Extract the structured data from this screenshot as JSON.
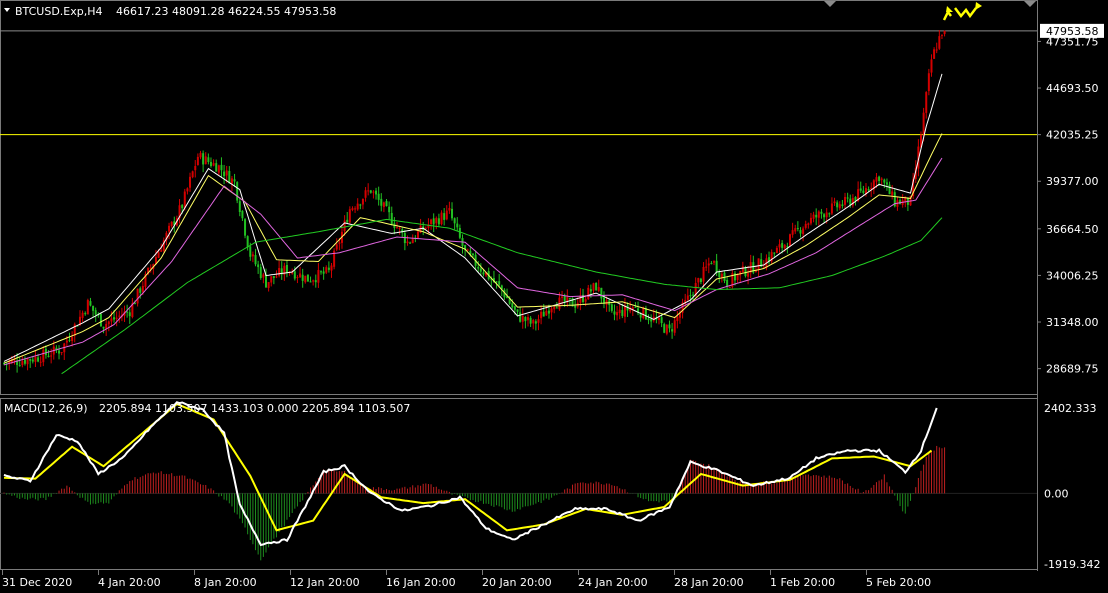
{
  "header": {
    "symbol": "BTCUSD.Exp,H4",
    "ohlc": "46617.23 48091.28 46224.55 47953.58"
  },
  "macd_header": {
    "label": "MACD(12,26,9)",
    "values": "2205.894 1103.507 1433.103 0.000 2205.894 1103.507"
  },
  "current_price_label": "47953.58",
  "colors": {
    "background": "#000000",
    "bull": "#d40000",
    "bear": "#22c022",
    "ma_fast": "#ffffff",
    "ma_mid": "#ffff66",
    "ma_slow": "#e066e0",
    "ma_long": "#22cc22",
    "level_line": "#ffff00",
    "macd_line": "#ffffff",
    "signal_line": "#ffff00",
    "hist_pos": "#c02020",
    "hist_neg": "#1e8c1e",
    "arrows": "#ffff00"
  },
  "chart_data": [
    {
      "type": "candlestick",
      "title": "BTCUSD.Exp,H4",
      "yticks": [
        "47351.75",
        "44693.50",
        "42035.25",
        "39377.00",
        "36664.50",
        "34006.25",
        "31348.00",
        "28689.75"
      ],
      "ylim": [
        27500,
        49000
      ],
      "level_line": 42035.25,
      "xticks": [
        "31 Dec 2020",
        "4 Jan 20:00",
        "8 Jan 20:00",
        "12 Jan 20:00",
        "16 Jan 20:00",
        "20 Jan 20:00",
        "24 Jan 20:00",
        "28 Jan 20:00",
        "1 Feb 20:00",
        "5 Feb 20:00"
      ],
      "close_path": [
        [
          0,
          29000
        ],
        [
          12,
          29300
        ],
        [
          22,
          29800
        ],
        [
          32,
          32400
        ],
        [
          38,
          31200
        ],
        [
          48,
          32000
        ],
        [
          60,
          35700
        ],
        [
          68,
          38000
        ],
        [
          74,
          40800
        ],
        [
          82,
          40200
        ],
        [
          88,
          39300
        ],
        [
          94,
          35200
        ],
        [
          100,
          33600
        ],
        [
          108,
          34400
        ],
        [
          116,
          33800
        ],
        [
          124,
          34200
        ],
        [
          132,
          37800
        ],
        [
          140,
          38900
        ],
        [
          148,
          37200
        ],
        [
          154,
          35900
        ],
        [
          162,
          36900
        ],
        [
          170,
          37600
        ],
        [
          176,
          35300
        ],
        [
          182,
          34400
        ],
        [
          190,
          33200
        ],
        [
          196,
          31700
        ],
        [
          202,
          31200
        ],
        [
          210,
          32500
        ],
        [
          218,
          32400
        ],
        [
          226,
          33400
        ],
        [
          232,
          31700
        ],
        [
          240,
          32200
        ],
        [
          248,
          31500
        ],
        [
          254,
          30800
        ],
        [
          260,
          32400
        ],
        [
          270,
          34900
        ],
        [
          276,
          33600
        ],
        [
          282,
          34200
        ],
        [
          290,
          34800
        ],
        [
          298,
          35800
        ],
        [
          306,
          37000
        ],
        [
          314,
          37700
        ],
        [
          322,
          38200
        ],
        [
          328,
          38800
        ],
        [
          334,
          39700
        ],
        [
          340,
          38200
        ],
        [
          346,
          38200
        ],
        [
          350,
          42100
        ],
        [
          354,
          46300
        ],
        [
          358,
          47953
        ]
      ],
      "moving_averages": [
        {
          "name": "ma_fast",
          "path": [
            [
              0,
              29100
            ],
            [
              30,
              31300
            ],
            [
              40,
              32100
            ],
            [
              60,
              35600
            ],
            [
              78,
              40100
            ],
            [
              90,
              38900
            ],
            [
              100,
              34000
            ],
            [
              110,
              34200
            ],
            [
              130,
              37000
            ],
            [
              148,
              36400
            ],
            [
              160,
              36700
            ],
            [
              176,
              35000
            ],
            [
              196,
              31700
            ],
            [
              210,
              32300
            ],
            [
              226,
              33000
            ],
            [
              248,
              31500
            ],
            [
              262,
              32600
            ],
            [
              272,
              34200
            ],
            [
              290,
              34600
            ],
            [
              306,
              36300
            ],
            [
              322,
              37900
            ],
            [
              334,
              39200
            ],
            [
              346,
              38700
            ],
            [
              352,
              42500
            ],
            [
              358,
              45500
            ]
          ]
        },
        {
          "name": "ma_mid",
          "path": [
            [
              0,
              29000
            ],
            [
              30,
              30800
            ],
            [
              40,
              31600
            ],
            [
              60,
              35000
            ],
            [
              78,
              39700
            ],
            [
              92,
              38200
            ],
            [
              104,
              34900
            ],
            [
              120,
              34800
            ],
            [
              136,
              37300
            ],
            [
              160,
              36500
            ],
            [
              176,
              35500
            ],
            [
              196,
              32200
            ],
            [
              216,
              32300
            ],
            [
              236,
              32500
            ],
            [
              256,
              31600
            ],
            [
              272,
              33800
            ],
            [
              290,
              34400
            ],
            [
              306,
              35700
            ],
            [
              322,
              37300
            ],
            [
              334,
              38600
            ],
            [
              346,
              38400
            ],
            [
              354,
              40900
            ],
            [
              358,
              42100
            ]
          ]
        },
        {
          "name": "ma_slow",
          "path": [
            [
              0,
              28900
            ],
            [
              30,
              30200
            ],
            [
              42,
              31200
            ],
            [
              64,
              34800
            ],
            [
              84,
              39100
            ],
            [
              98,
              37500
            ],
            [
              112,
              35000
            ],
            [
              128,
              35300
            ],
            [
              150,
              36200
            ],
            [
              176,
              35900
            ],
            [
              196,
              33300
            ],
            [
              216,
              32800
            ],
            [
              236,
              32900
            ],
            [
              256,
              32000
            ],
            [
              272,
              33200
            ],
            [
              292,
              34100
            ],
            [
              310,
              35300
            ],
            [
              326,
              36800
            ],
            [
              340,
              38100
            ],
            [
              348,
              38300
            ],
            [
              358,
              40700
            ]
          ]
        },
        {
          "name": "ma_long",
          "path": [
            [
              22,
              28400
            ],
            [
              46,
              30900
            ],
            [
              70,
              33600
            ],
            [
              96,
              35900
            ],
            [
              120,
              36500
            ],
            [
              146,
              37200
            ],
            [
              170,
              36700
            ],
            [
              196,
              35300
            ],
            [
              226,
              34200
            ],
            [
              252,
              33500
            ],
            [
              272,
              33200
            ],
            [
              296,
              33300
            ],
            [
              316,
              34000
            ],
            [
              336,
              35100
            ],
            [
              350,
              36000
            ],
            [
              358,
              37300
            ]
          ]
        }
      ]
    },
    {
      "type": "line",
      "title": "MACD(12,26,9)",
      "yticks": [
        "2402.333",
        "0.00",
        "-1919.342"
      ],
      "ylim": [
        -1919.342,
        2402.333
      ],
      "series": [
        {
          "name": "MACD",
          "values_path": [
            [
              0,
              450
            ],
            [
              10,
              320
            ],
            [
              20,
              1500
            ],
            [
              28,
              1350
            ],
            [
              36,
              500
            ],
            [
              46,
              950
            ],
            [
              56,
              1700
            ],
            [
              66,
              2350
            ],
            [
              76,
              2150
            ],
            [
              84,
              1550
            ],
            [
              90,
              -300
            ],
            [
              98,
              -1300
            ],
            [
              108,
              -1200
            ],
            [
              122,
              550
            ],
            [
              130,
              700
            ],
            [
              140,
              0
            ],
            [
              152,
              -450
            ],
            [
              164,
              -300
            ],
            [
              174,
              -100
            ],
            [
              184,
              -900
            ],
            [
              194,
              -1200
            ],
            [
              206,
              -800
            ],
            [
              218,
              -400
            ],
            [
              230,
              -400
            ],
            [
              242,
              -700
            ],
            [
              254,
              -350
            ],
            [
              262,
              800
            ],
            [
              272,
              600
            ],
            [
              286,
              200
            ],
            [
              300,
              400
            ],
            [
              310,
              900
            ],
            [
              322,
              1100
            ],
            [
              334,
              1100
            ],
            [
              344,
              550
            ],
            [
              350,
              1100
            ],
            [
              356,
              2205
            ]
          ]
        },
        {
          "name": "Signal",
          "values_path": [
            [
              0,
              400
            ],
            [
              12,
              380
            ],
            [
              26,
              1200
            ],
            [
              38,
              700
            ],
            [
              52,
              1500
            ],
            [
              66,
              2300
            ],
            [
              80,
              1900
            ],
            [
              94,
              450
            ],
            [
              104,
              -950
            ],
            [
              118,
              -700
            ],
            [
              130,
              500
            ],
            [
              144,
              -100
            ],
            [
              160,
              -250
            ],
            [
              176,
              -150
            ],
            [
              192,
              -950
            ],
            [
              206,
              -800
            ],
            [
              222,
              -400
            ],
            [
              236,
              -550
            ],
            [
              252,
              -350
            ],
            [
              266,
              500
            ],
            [
              282,
              200
            ],
            [
              300,
              350
            ],
            [
              316,
              900
            ],
            [
              332,
              950
            ],
            [
              346,
              700
            ],
            [
              354,
              1100
            ]
          ]
        },
        {
          "name": "Histogram",
          "values_path": [
            [
              0,
              0
            ],
            [
              8,
              -150
            ],
            [
              16,
              -150
            ],
            [
              24,
              200
            ],
            [
              32,
              -250
            ],
            [
              40,
              -250
            ],
            [
              48,
              350
            ],
            [
              58,
              550
            ],
            [
              68,
              450
            ],
            [
              78,
              150
            ],
            [
              86,
              -250
            ],
            [
              92,
              -900
            ],
            [
              98,
              -1700
            ],
            [
              106,
              -900
            ],
            [
              114,
              -150
            ],
            [
              122,
              600
            ],
            [
              130,
              550
            ],
            [
              138,
              150
            ],
            [
              150,
              100
            ],
            [
              162,
              250
            ],
            [
              172,
              -50
            ],
            [
              184,
              -250
            ],
            [
              194,
              -450
            ],
            [
              208,
              -150
            ],
            [
              220,
              300
            ],
            [
              232,
              250
            ],
            [
              246,
              -200
            ],
            [
              256,
              -200
            ],
            [
              262,
              850
            ],
            [
              270,
              700
            ],
            [
              282,
              250
            ],
            [
              296,
              300
            ],
            [
              306,
              500
            ],
            [
              318,
              400
            ],
            [
              328,
              0
            ],
            [
              336,
              450
            ],
            [
              344,
              -550
            ],
            [
              352,
              950
            ],
            [
              356,
              1200
            ]
          ]
        }
      ]
    }
  ]
}
